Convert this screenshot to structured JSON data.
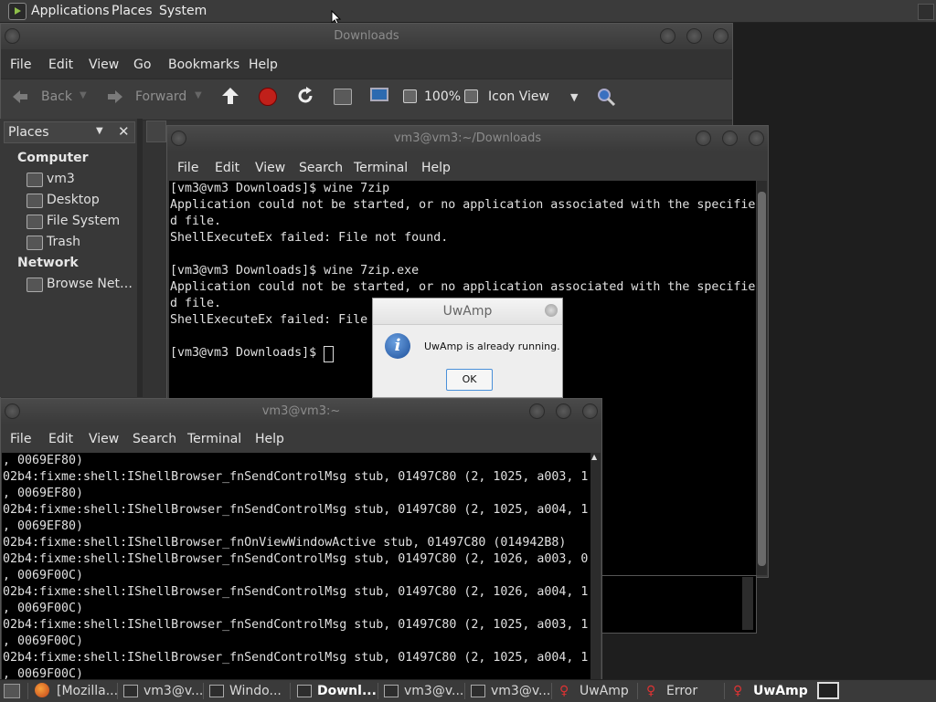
{
  "top_panel": {
    "menus": [
      "Applications",
      "Places",
      "System"
    ]
  },
  "downloads": {
    "title": "Downloads",
    "menu": [
      "File",
      "Edit",
      "View",
      "Go",
      "Bookmarks",
      "Help"
    ],
    "toolbar": {
      "back": "Back",
      "forward": "Forward",
      "zoom": "100%",
      "view_mode": "Icon View"
    },
    "sidebar": {
      "header": "Places",
      "computer_label": "Computer",
      "computer_items": [
        "vm3",
        "Desktop",
        "File System",
        "Trash"
      ],
      "network_label": "Network",
      "network_items": [
        "Browse Net…"
      ]
    }
  },
  "terminal_downloads": {
    "title": "vm3@vm3:~/Downloads",
    "menu": [
      "File",
      "Edit",
      "View",
      "Search",
      "Terminal",
      "Help"
    ],
    "lines": [
      "[vm3@vm3 Downloads]$ wine 7zip",
      "Application could not be started, or no application associated with the specifie",
      "d file.",
      "ShellExecuteEx failed: File not found.",
      "",
      "[vm3@vm3 Downloads]$ wine 7zip.exe",
      "Application could not be started, or no application associated with the specifie",
      "d file.",
      "ShellExecuteEx failed: File",
      "",
      "[vm3@vm3 Downloads]$ "
    ]
  },
  "dialog": {
    "title": "UwAmp",
    "message": "UwAmp is already running.",
    "ok": "OK"
  },
  "terminal_home": {
    "title": "vm3@vm3:~",
    "menu": [
      "File",
      "Edit",
      "View",
      "Search",
      "Terminal",
      "Help"
    ],
    "lines": [
      ", 0069EF80)",
      "02b4:fixme:shell:IShellBrowser_fnSendControlMsg stub, 01497C80 (2, 1025, a003, 1",
      ", 0069EF80)",
      "02b4:fixme:shell:IShellBrowser_fnSendControlMsg stub, 01497C80 (2, 1025, a004, 1",
      ", 0069EF80)",
      "02b4:fixme:shell:IShellBrowser_fnOnViewWindowActive stub, 01497C80 (014942B8)",
      "02b4:fixme:shell:IShellBrowser_fnSendControlMsg stub, 01497C80 (2, 1026, a003, 0",
      ", 0069F00C)",
      "02b4:fixme:shell:IShellBrowser_fnSendControlMsg stub, 01497C80 (2, 1026, a004, 1",
      ", 0069F00C)",
      "02b4:fixme:shell:IShellBrowser_fnSendControlMsg stub, 01497C80 (2, 1025, a003, 1",
      ", 0069F00C)",
      "02b4:fixme:shell:IShellBrowser_fnSendControlMsg stub, 01497C80 (2, 1025, a004, 1",
      ", 0069F00C)"
    ]
  },
  "taskbar": {
    "items": [
      "[Mozilla...",
      "vm3@v...",
      "Windo...",
      "Downl...",
      "vm3@v...",
      "vm3@v...",
      "UwAmp",
      "Error",
      "UwAmp"
    ]
  }
}
